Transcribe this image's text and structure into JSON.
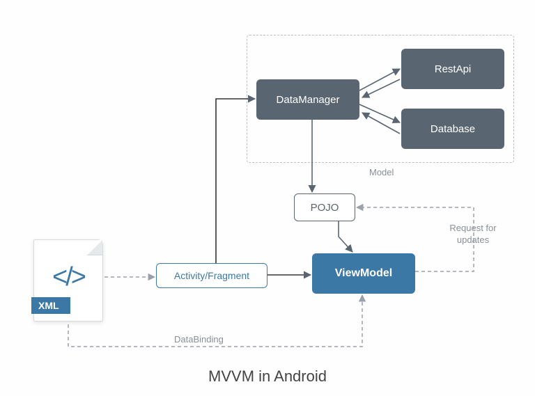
{
  "title": "MVVM in Android",
  "nodes": {
    "datamanager": "DataManager",
    "restapi": "RestApi",
    "database": "Database",
    "pojo": "POJO",
    "viewmodel": "ViewModel",
    "activity": "Activity/Fragment"
  },
  "labels": {
    "model": "Model",
    "request": "Request for updates",
    "databinding": "DataBinding"
  },
  "xml": {
    "band": "XML",
    "glyph": "</>"
  },
  "colors": {
    "dark": "#5a6572",
    "blue": "#3b78a6",
    "gray": "#8a9097"
  }
}
